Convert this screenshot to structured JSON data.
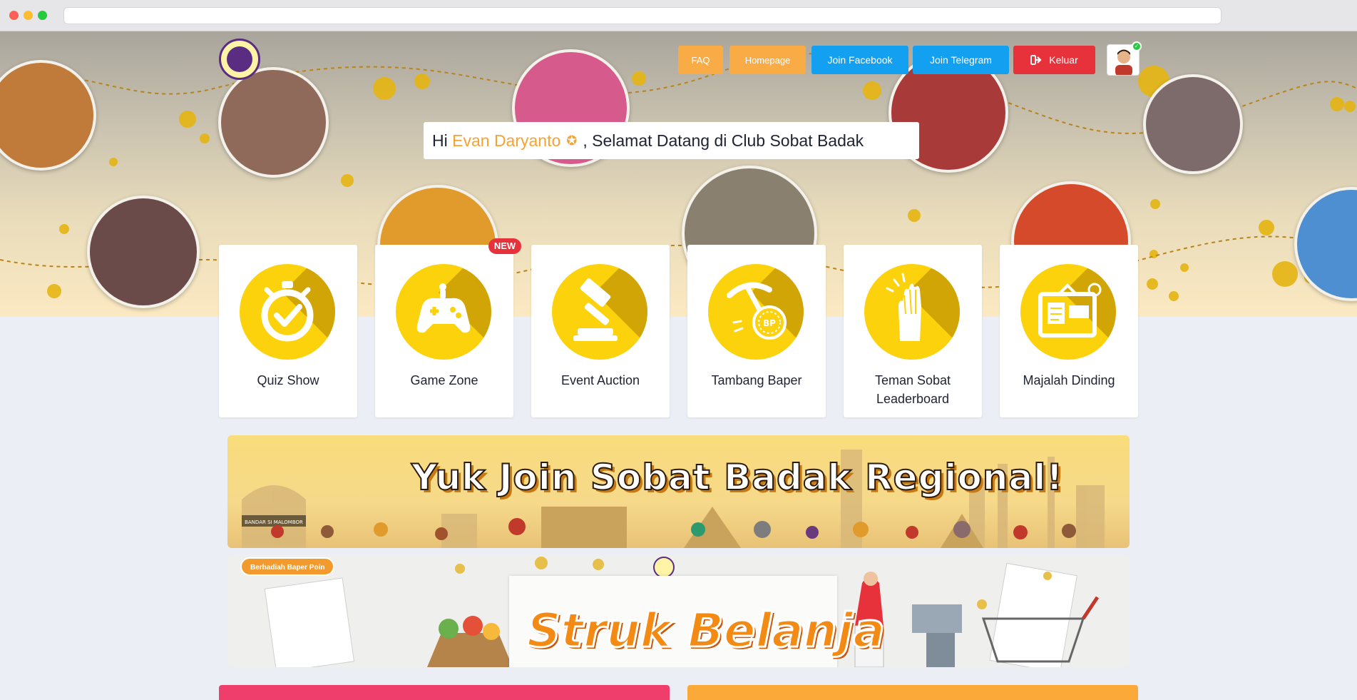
{
  "nav": {
    "faq": "FAQ",
    "homepage": "Homepage",
    "join_facebook": "Join Facebook",
    "join_telegram": "Join Telegram",
    "logout": "Keluar"
  },
  "welcome": {
    "greeting": "Hi",
    "user_name": "Evan Daryanto",
    "message": ", Selamat Datang di Club Sobat Badak"
  },
  "menu": [
    {
      "label": "Quiz Show",
      "icon": "stopwatch-icon"
    },
    {
      "label": "Game Zone",
      "icon": "gamepad-icon",
      "badge": "NEW"
    },
    {
      "label": "Event Auction",
      "icon": "gavel-icon"
    },
    {
      "label": "Tambang Baper",
      "icon": "pickaxe-coin-icon",
      "coin_text": "BP"
    },
    {
      "label": "Teman Sobat Leaderboard",
      "icon": "high-five-icon"
    },
    {
      "label": "Majalah Dinding",
      "icon": "bulletin-board-icon"
    }
  ],
  "banners": {
    "regional": {
      "headline": "Yuk Join Sobat Badak Regional!",
      "sign_text": "BANDAR SI MALOMBOR"
    },
    "struk": {
      "tag": "Berhadiah Baper Poin",
      "headline": "Struk Belanja"
    }
  },
  "colors": {
    "accent_orange": "#f9ac45",
    "facebook_blue": "#13a0f0",
    "logout_red": "#e8323b",
    "icon_yellow": "#fbd20c",
    "name_orange": "#f7a234"
  }
}
